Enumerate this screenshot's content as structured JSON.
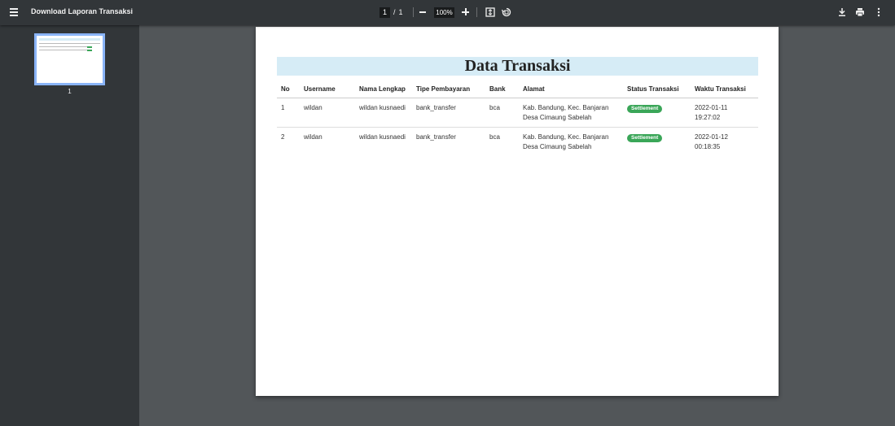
{
  "toolbar": {
    "doc_title": "Download Laporan Transaksi",
    "current_page": "1",
    "page_separator": "/",
    "total_pages": "1",
    "zoom": "100%"
  },
  "sidebar": {
    "thumbnail_label": "1"
  },
  "report": {
    "title": "Data Transaksi",
    "headers": {
      "no": "No",
      "username": "Username",
      "nama_lengkap": "Nama Lengkap",
      "tipe_pembayaran": "Tipe Pembayaran",
      "bank": "Bank",
      "alamat": "Alamat",
      "status": "Status Transaksi",
      "waktu": "Waktu Transaksi"
    },
    "rows": [
      {
        "no": "1",
        "username": "wildan",
        "nama_lengkap": "wildan kusnaedi",
        "tipe_pembayaran": "bank_transfer",
        "bank": "bca",
        "alamat_1": "Kab. Bandung, Kec. Banjaran",
        "alamat_2": "Desa Cimaung Sabelah",
        "status": "Settlement",
        "waktu_date": "2022-01-11",
        "waktu_time": "19:27:02"
      },
      {
        "no": "2",
        "username": "wildan",
        "nama_lengkap": "wildan kusnaedi",
        "tipe_pembayaran": "bank_transfer",
        "bank": "bca",
        "alamat_1": "Kab. Bandung, Kec. Banjaran",
        "alamat_2": "Desa Cimaung Sabelah",
        "status": "Settlement",
        "waktu_date": "2022-01-12",
        "waktu_time": "00:18:35"
      }
    ]
  },
  "colors": {
    "toolbar_bg": "#323639",
    "viewer_bg": "#525659",
    "title_band": "#d6ecf6",
    "badge_green": "#3aa658",
    "thumb_border": "#8ab4f8"
  },
  "icons": {
    "menu": "hamburger-menu-icon",
    "zoom_out": "minus-icon",
    "zoom_in": "plus-icon",
    "fit": "fit-to-page-icon",
    "rotate": "rotate-icon",
    "download": "download-icon",
    "print": "print-icon",
    "more": "more-vert-icon"
  }
}
